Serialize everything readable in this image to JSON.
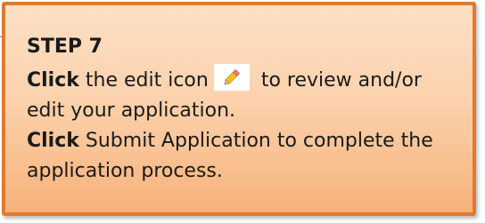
{
  "callout": {
    "title": "STEP 7",
    "line1": {
      "bold": "Click",
      "before_icon": " the edit icon",
      "after_icon": " to review and/or edit your application."
    },
    "line2": {
      "bold": "Click",
      "text": " Submit Application to complete the application process."
    },
    "icon": "pencil-edit-icon",
    "colors": {
      "border": "#e07a2f",
      "fill_top": "#fde0c5",
      "fill_bottom": "#f7b27a"
    }
  }
}
